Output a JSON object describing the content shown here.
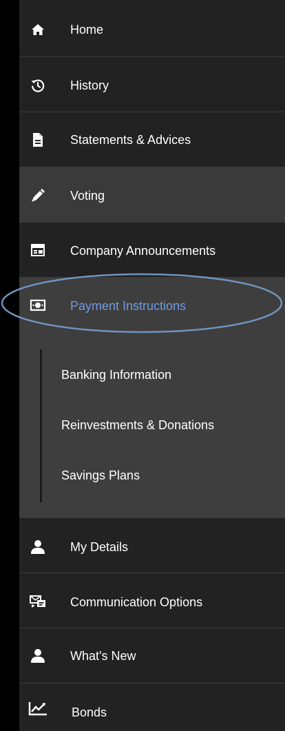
{
  "menu": {
    "items": [
      {
        "label": "Home",
        "icon": "home-icon"
      },
      {
        "label": "History",
        "icon": "history-icon"
      },
      {
        "label": "Statements & Advices",
        "icon": "document-icon"
      },
      {
        "label": "Voting",
        "icon": "pen-icon"
      },
      {
        "label": "Company Announcements",
        "icon": "announcement-icon"
      },
      {
        "label": "Payment Instructions",
        "icon": "money-icon"
      },
      {
        "label": "My Details",
        "icon": "user-icon"
      },
      {
        "label": "Communication Options",
        "icon": "communication-icon"
      },
      {
        "label": "What's New",
        "icon": "user-icon"
      },
      {
        "label": "Bonds",
        "icon": "chart-icon"
      }
    ],
    "submenu": {
      "items": [
        {
          "label": "Banking Information"
        },
        {
          "label": "Reinvestments & Donations"
        },
        {
          "label": "Savings Plans"
        }
      ]
    }
  },
  "colors": {
    "background": "#000000",
    "item_bg": "#222222",
    "active_bg": "#3e3e3e",
    "active_text": "#6f9ae2",
    "highlight_ring": "#6f95c0"
  }
}
